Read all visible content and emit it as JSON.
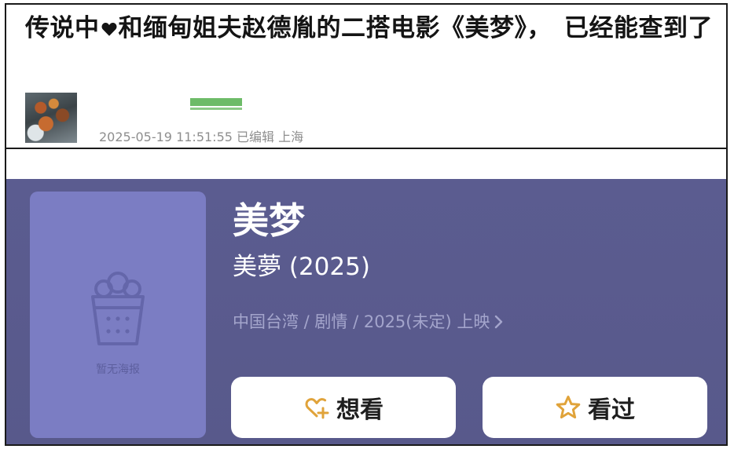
{
  "article": {
    "headline_part1": "传说中",
    "headline_part2": "和缅甸姐夫赵德胤的二搭电影《美梦》，　已经能查到了",
    "post_meta": "2025-05-19 11:51:55 已编辑 上海"
  },
  "movie": {
    "title": "美梦",
    "original_title": "美夢 (2025)",
    "meta": "中国台湾 / 剧情 / 2025(未定) 上映",
    "poster_placeholder": "暂无海报",
    "want_label": "想看",
    "watched_label": "看过"
  },
  "colors": {
    "card_background": "#5b5c90",
    "poster_background": "#7b7dc3",
    "button_icon_accent": "#e0a33a",
    "meta_text": "#a4a5cc"
  },
  "icons": {
    "heart": "heart-icon",
    "popcorn": "popcorn-icon",
    "chevron": "chevron-right-icon",
    "heart_plus": "heart-plus-icon",
    "star": "star-icon"
  }
}
